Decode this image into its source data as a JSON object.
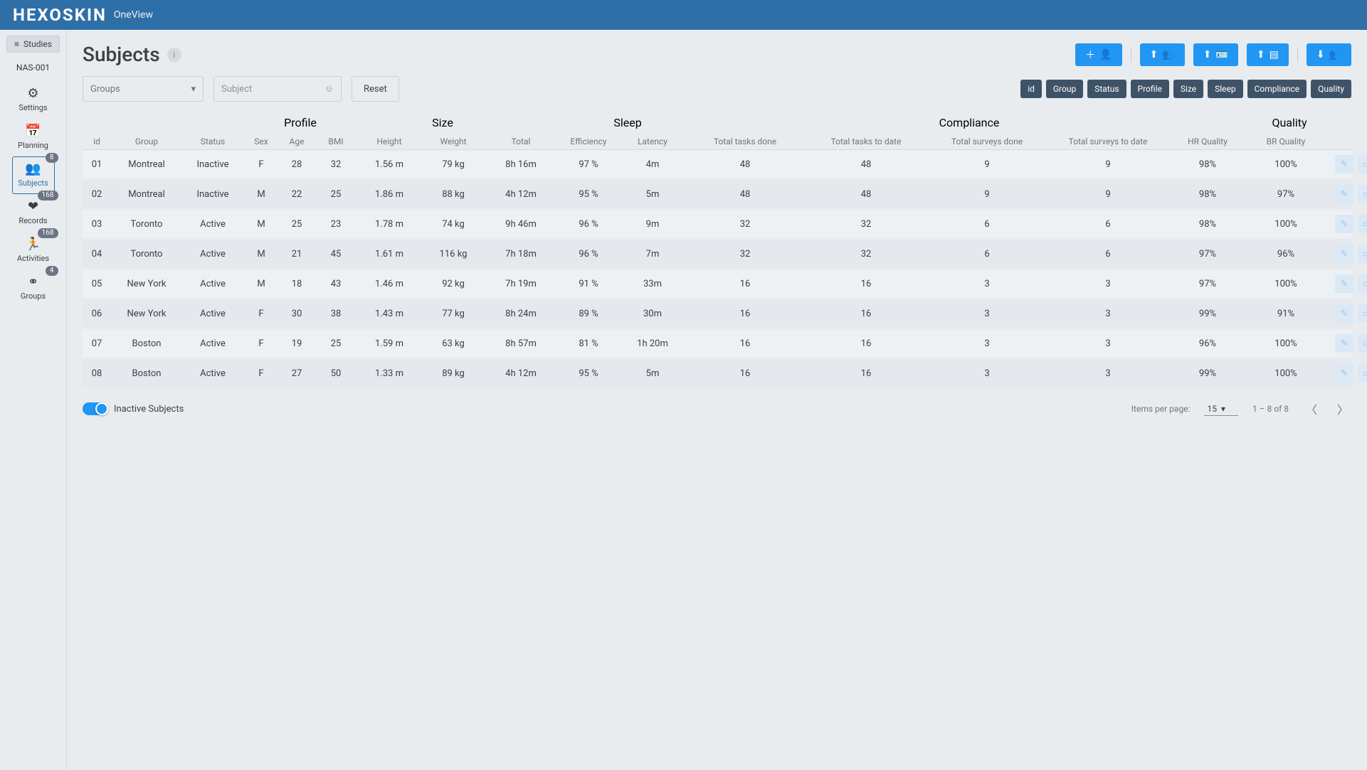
{
  "brand": {
    "name": "HEXOSKIN",
    "product": "OneView"
  },
  "sidebar": {
    "studies_label": "Studies",
    "study_code": "NAS-001",
    "items": [
      {
        "label": "Settings",
        "icon": "⚙",
        "badge": null
      },
      {
        "label": "Planning",
        "icon": "📅",
        "badge": null
      },
      {
        "label": "Subjects",
        "icon": "👥",
        "badge": "8",
        "active": true
      },
      {
        "label": "Records",
        "icon": "❤",
        "badge": "168"
      },
      {
        "label": "Activities",
        "icon": "🏃",
        "badge": "168"
      },
      {
        "label": "Groups",
        "icon": "⚭",
        "badge": "4"
      }
    ]
  },
  "page": {
    "title": "Subjects",
    "action_buttons": [
      "add-person",
      "upload-group",
      "upload-card",
      "upload-doc",
      "download-group"
    ],
    "filters": {
      "groups_label": "Groups",
      "subject_label": "Subject",
      "reset_label": "Reset"
    },
    "column_chips": [
      "id",
      "Group",
      "Status",
      "Profile",
      "Size",
      "Sleep",
      "Compliance",
      "Quality"
    ]
  },
  "table": {
    "group_headers": [
      "",
      "",
      "",
      "Profile",
      "Size",
      "Sleep",
      "Compliance",
      "Quality",
      ""
    ],
    "headers": [
      "id",
      "Group",
      "Status",
      "Sex",
      "Age",
      "BMI",
      "Height",
      "Weight",
      "Total",
      "Efficiency",
      "Latency",
      "Total tasks done",
      "Total tasks to date",
      "Total surveys done",
      "Total surveys to date",
      "HR Quality",
      "BR Quality",
      ""
    ],
    "rows": [
      {
        "id": "01",
        "group": "Montreal",
        "status": "Inactive",
        "sex": "F",
        "age": "28",
        "bmi": "32",
        "height": "1.56 m",
        "weight": "79 kg",
        "total": "8h 16m",
        "eff": "97 %",
        "lat": "4m",
        "ttd": "48",
        "tttd": "48",
        "tsd": "9",
        "tstd": "9",
        "hr": "98%",
        "br": "100%"
      },
      {
        "id": "02",
        "group": "Montreal",
        "status": "Inactive",
        "sex": "M",
        "age": "22",
        "bmi": "25",
        "height": "1.86 m",
        "weight": "88 kg",
        "total": "4h 12m",
        "eff": "95 %",
        "lat": "5m",
        "ttd": "48",
        "tttd": "48",
        "tsd": "9",
        "tstd": "9",
        "hr": "98%",
        "br": "97%"
      },
      {
        "id": "03",
        "group": "Toronto",
        "status": "Active",
        "sex": "M",
        "age": "25",
        "bmi": "23",
        "height": "1.78 m",
        "weight": "74 kg",
        "total": "9h 46m",
        "eff": "96 %",
        "lat": "9m",
        "ttd": "32",
        "tttd": "32",
        "tsd": "6",
        "tstd": "6",
        "hr": "98%",
        "br": "100%"
      },
      {
        "id": "04",
        "group": "Toronto",
        "status": "Active",
        "sex": "M",
        "age": "21",
        "bmi": "45",
        "height": "1.61 m",
        "weight": "116 kg",
        "total": "7h 18m",
        "eff": "96 %",
        "lat": "7m",
        "ttd": "32",
        "tttd": "32",
        "tsd": "6",
        "tstd": "6",
        "hr": "97%",
        "br": "96%"
      },
      {
        "id": "05",
        "group": "New York",
        "status": "Active",
        "sex": "M",
        "age": "18",
        "bmi": "43",
        "height": "1.46 m",
        "weight": "92 kg",
        "total": "7h 19m",
        "eff": "91 %",
        "lat": "33m",
        "ttd": "16",
        "tttd": "16",
        "tsd": "3",
        "tstd": "3",
        "hr": "97%",
        "br": "100%"
      },
      {
        "id": "06",
        "group": "New York",
        "status": "Active",
        "sex": "F",
        "age": "30",
        "bmi": "38",
        "height": "1.43 m",
        "weight": "77 kg",
        "total": "8h 24m",
        "eff": "89 %",
        "lat": "30m",
        "ttd": "16",
        "tttd": "16",
        "tsd": "3",
        "tstd": "3",
        "hr": "99%",
        "br": "91%"
      },
      {
        "id": "07",
        "group": "Boston",
        "status": "Active",
        "sex": "F",
        "age": "19",
        "bmi": "25",
        "height": "1.59 m",
        "weight": "63 kg",
        "total": "8h 57m",
        "eff": "81 %",
        "lat": "1h 20m",
        "ttd": "16",
        "tttd": "16",
        "tsd": "3",
        "tstd": "3",
        "hr": "96%",
        "br": "100%"
      },
      {
        "id": "08",
        "group": "Boston",
        "status": "Active",
        "sex": "F",
        "age": "27",
        "bmi": "50",
        "height": "1.33 m",
        "weight": "89 kg",
        "total": "4h 12m",
        "eff": "95 %",
        "lat": "5m",
        "ttd": "16",
        "tttd": "16",
        "tsd": "3",
        "tstd": "3",
        "hr": "99%",
        "br": "100%"
      }
    ]
  },
  "footer": {
    "inactive_label": "Inactive Subjects",
    "items_per_page_label": "Items per page:",
    "items_per_page_value": "15",
    "range_text": "1 – 8 of 8"
  }
}
